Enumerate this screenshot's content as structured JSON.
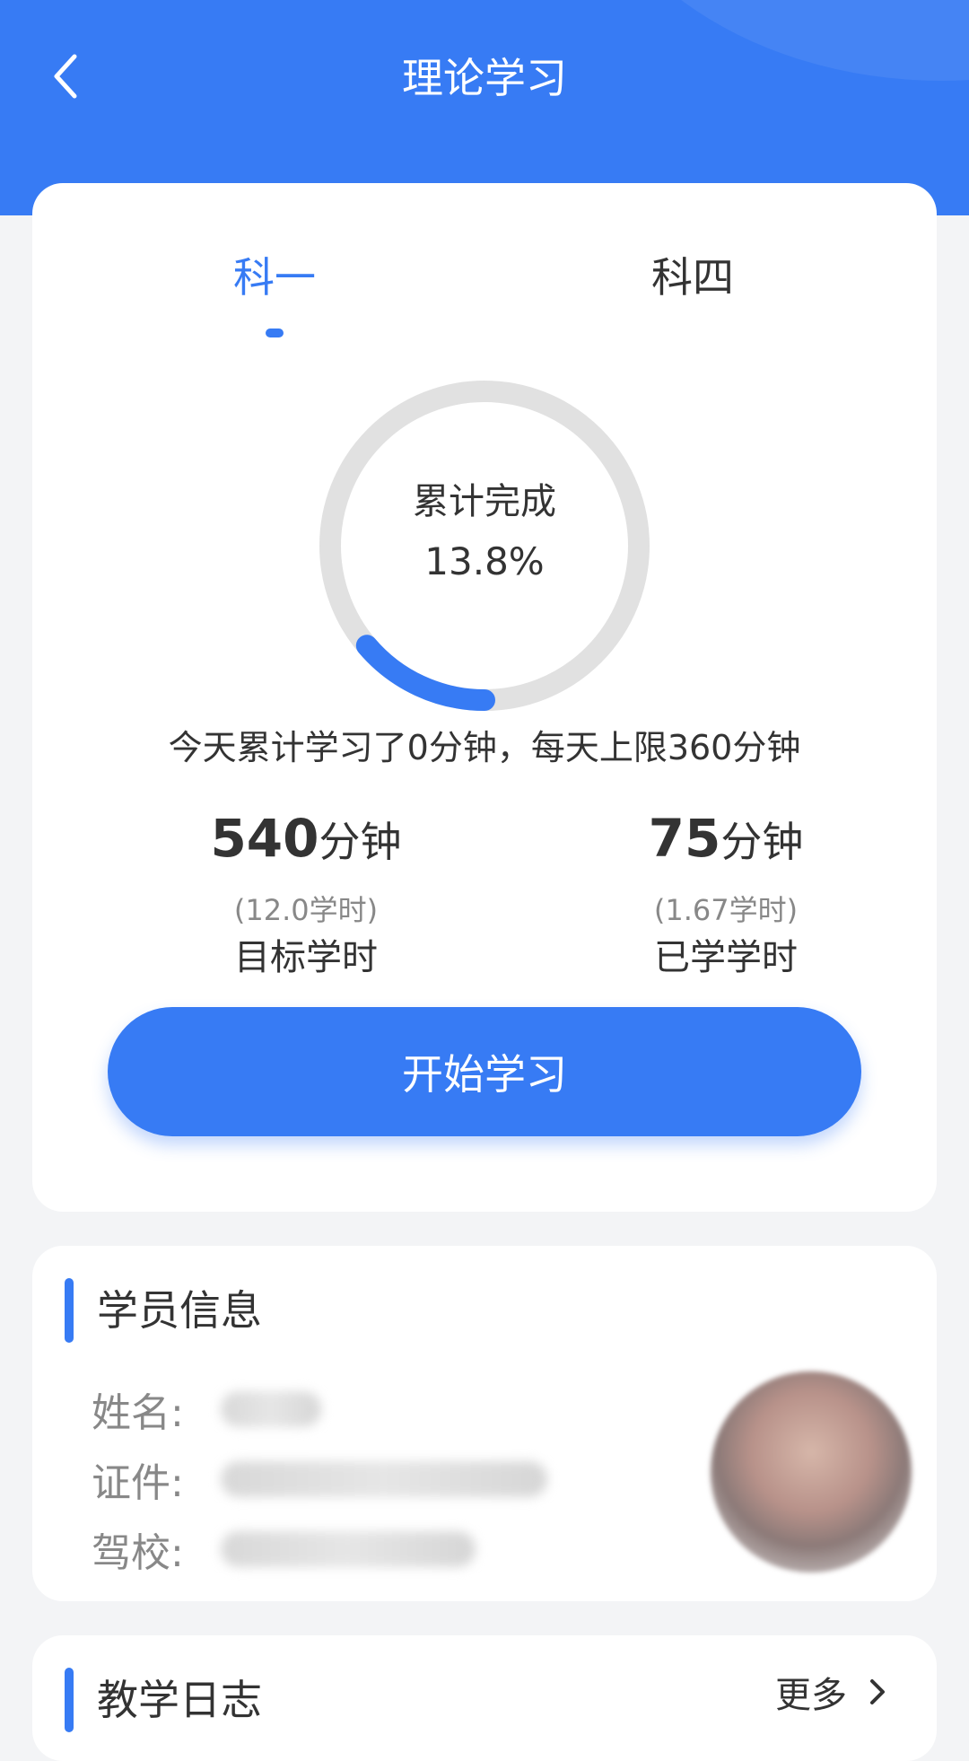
{
  "header": {
    "title": "理论学习",
    "back_icon": "chevron-left-icon"
  },
  "colors": {
    "primary": "#377bf4",
    "ring_track": "#e1e1e1",
    "background": "#f3f4f6"
  },
  "tabs": [
    {
      "label": "科一",
      "active": true
    },
    {
      "label": "科四",
      "active": false
    }
  ],
  "progress": {
    "label": "累计完成",
    "value_text": "13.8%",
    "fraction": 0.138
  },
  "today": {
    "text": "今天累计学习了0分钟，每天上限360分钟"
  },
  "stats": {
    "target": {
      "minutes": "540",
      "unit": "分钟",
      "hours": "(12.0学时)",
      "caption": "目标学时"
    },
    "learned": {
      "minutes": "75",
      "unit": "分钟",
      "hours": "(1.67学时)",
      "caption": "已学学时"
    }
  },
  "start_button": {
    "label": "开始学习"
  },
  "student_info": {
    "title": "学员信息",
    "fields": [
      {
        "label": "姓名:",
        "value_hidden": true
      },
      {
        "label": "证件:",
        "value_hidden": true
      },
      {
        "label": "驾校:",
        "value_hidden": true
      }
    ]
  },
  "teaching_log": {
    "title": "教学日志",
    "more_label": "更多",
    "more_icon": "chevron-right-icon"
  }
}
